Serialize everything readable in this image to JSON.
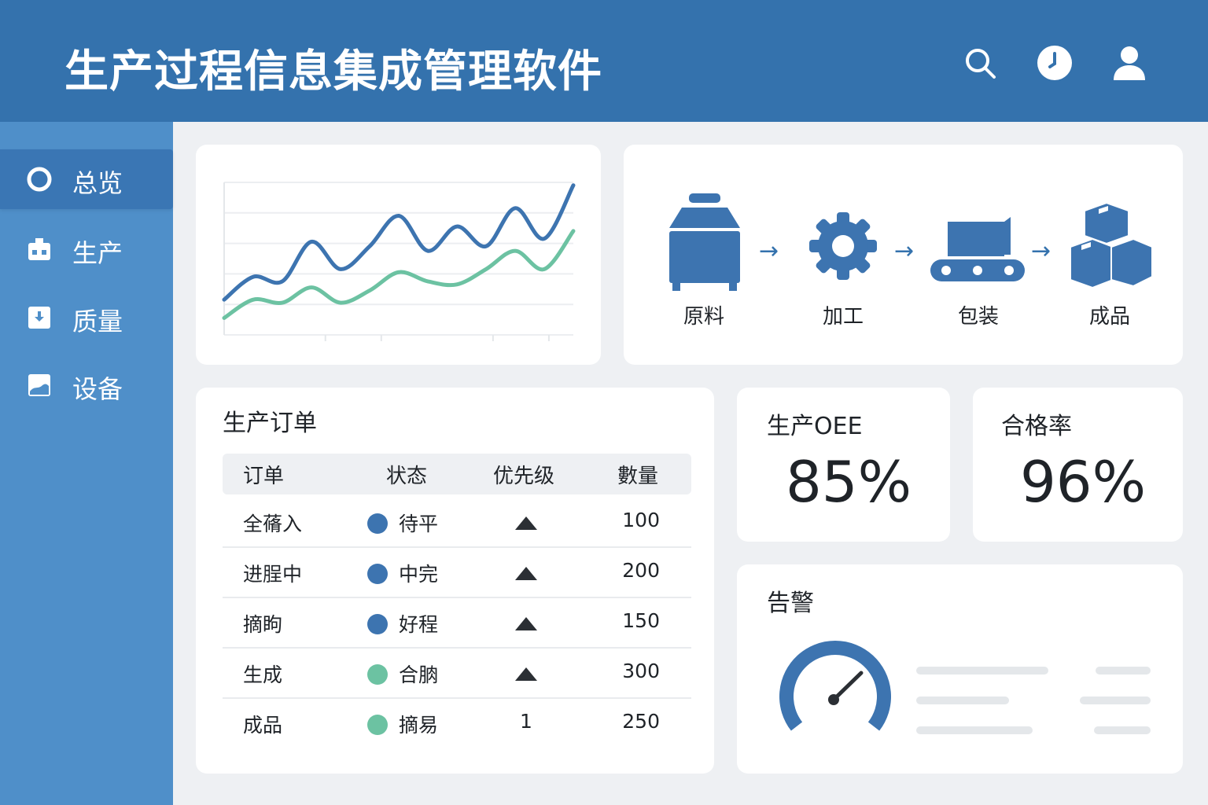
{
  "header": {
    "title": "生产过程信息集成管理软件",
    "icons": [
      "search-icon",
      "clock-icon",
      "user-icon"
    ],
    "accent_color": "#3472ad"
  },
  "sidebar": {
    "items": [
      {
        "label": "总览",
        "icon": "circle-icon",
        "active": true
      },
      {
        "label": "生产",
        "icon": "factory-icon",
        "active": false
      },
      {
        "label": "质量",
        "icon": "download-box-icon",
        "active": false
      },
      {
        "label": "设备",
        "icon": "image-icon",
        "active": false
      }
    ]
  },
  "process": {
    "steps": [
      {
        "label": "原料",
        "icon": "tank-icon"
      },
      {
        "label": "加工",
        "icon": "gear-icon"
      },
      {
        "label": "包装",
        "icon": "conveyor-icon"
      },
      {
        "label": "成品",
        "icon": "boxes-icon"
      }
    ],
    "arrow": "→"
  },
  "orders": {
    "title": "生产订单",
    "columns": [
      "订单",
      "状态",
      "优先级",
      "數量"
    ],
    "rows": [
      {
        "order": "全蓨入",
        "status": "待平",
        "status_color": "#3d74b0",
        "priority": "▲",
        "qty": "100"
      },
      {
        "order": "进脭中",
        "status": "中完",
        "status_color": "#3d74b0",
        "priority": "▲",
        "qty": "200"
      },
      {
        "order": "摘眗",
        "status": "好程",
        "status_color": "#3d74b0",
        "priority": "▲",
        "qty": "150"
      },
      {
        "order": "生成",
        "status": "合朒",
        "status_color": "#6cc2a2",
        "priority": "▲",
        "qty": "300"
      },
      {
        "order": "成品",
        "status": "摘易",
        "status_color": "#6cc2a2",
        "priority": "1",
        "qty": "250"
      }
    ]
  },
  "kpi": {
    "oee": {
      "title": "生产OEE",
      "value": "85%"
    },
    "yield": {
      "title": "合格率",
      "value": "96%"
    }
  },
  "alarm": {
    "title": "告警",
    "gauge_icon": "gauge-icon"
  },
  "chart_data": {
    "type": "line",
    "x": [
      0,
      1,
      2,
      3,
      4,
      5,
      6,
      7,
      8,
      9,
      10,
      11,
      12
    ],
    "series": [
      {
        "values": [
          20,
          35,
          32,
          58,
          40,
          55,
          75,
          52,
          68,
          55,
          80,
          60,
          95
        ],
        "color": "#3d74b0"
      },
      {
        "values": [
          8,
          20,
          18,
          28,
          18,
          26,
          38,
          32,
          30,
          40,
          52,
          40,
          65
        ],
        "color": "#6cc2a2"
      }
    ],
    "ylim": [
      0,
      100
    ],
    "grid": true
  }
}
